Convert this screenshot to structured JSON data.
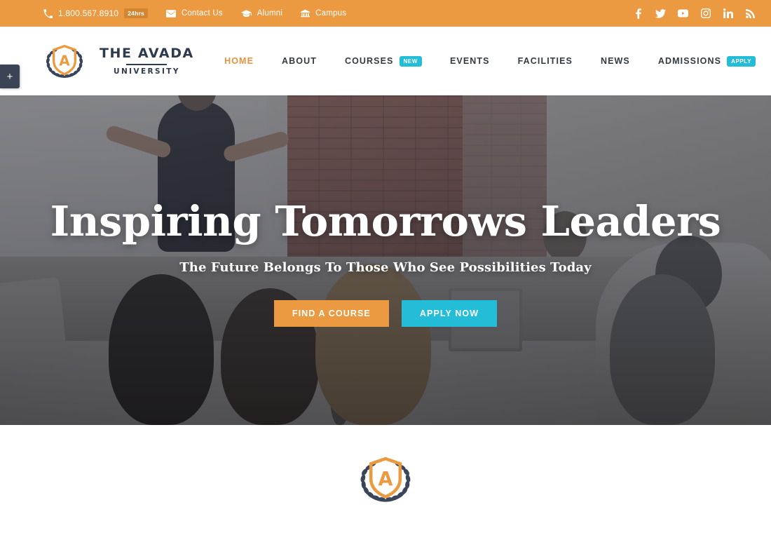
{
  "topbar": {
    "phone": {
      "icon": "phone-icon",
      "number": "1.800.567.8910",
      "badge": "24hrs"
    },
    "links": [
      {
        "icon": "envelope-icon",
        "label": "Contact Us"
      },
      {
        "icon": "graduation-cap-icon",
        "label": "Alumni"
      },
      {
        "icon": "bank-icon",
        "label": "Campus"
      }
    ],
    "social": [
      {
        "name": "facebook-icon",
        "label": "Facebook"
      },
      {
        "name": "twitter-icon",
        "label": "Twitter"
      },
      {
        "name": "youtube-icon",
        "label": "YouTube"
      },
      {
        "name": "instagram-icon",
        "label": "Instagram"
      },
      {
        "name": "linkedin-icon",
        "label": "LinkedIn"
      },
      {
        "name": "rss-icon",
        "label": "RSS"
      }
    ],
    "background_color": "#eb9a41"
  },
  "side_tab": {
    "icon": "plus-icon",
    "label": "+",
    "background_color": "#3a4454"
  },
  "header": {
    "logo": {
      "title": "THE AVADA",
      "subtitle": "UNIVERSITY",
      "mark": "laurel-shield-a-logo"
    },
    "nav": [
      {
        "label": "HOME",
        "active": true,
        "badge": null
      },
      {
        "label": "ABOUT",
        "active": false,
        "badge": null
      },
      {
        "label": "COURSES",
        "active": false,
        "badge": "NEW"
      },
      {
        "label": "EVENTS",
        "active": false,
        "badge": null
      },
      {
        "label": "FACILITIES",
        "active": false,
        "badge": null
      },
      {
        "label": "NEWS",
        "active": false,
        "badge": null
      },
      {
        "label": "ADMISSIONS",
        "active": false,
        "badge": "APPLY"
      }
    ],
    "active_color": "#e8913a",
    "badge_color": "#23bdd8"
  },
  "hero": {
    "title": "Inspiring Tomorrows Leaders",
    "subtitle": "The Future Belongs To Those Who See Possibilities Today",
    "buttons": [
      {
        "label": "FIND A COURSE",
        "color": "#eb9a41"
      },
      {
        "label": "APPLY NOW",
        "color": "#23bdd8"
      }
    ],
    "image_description": "Lecture hall with presenter and seated audience"
  },
  "below_hero": {
    "logo_mark": "laurel-shield-a-logo"
  }
}
